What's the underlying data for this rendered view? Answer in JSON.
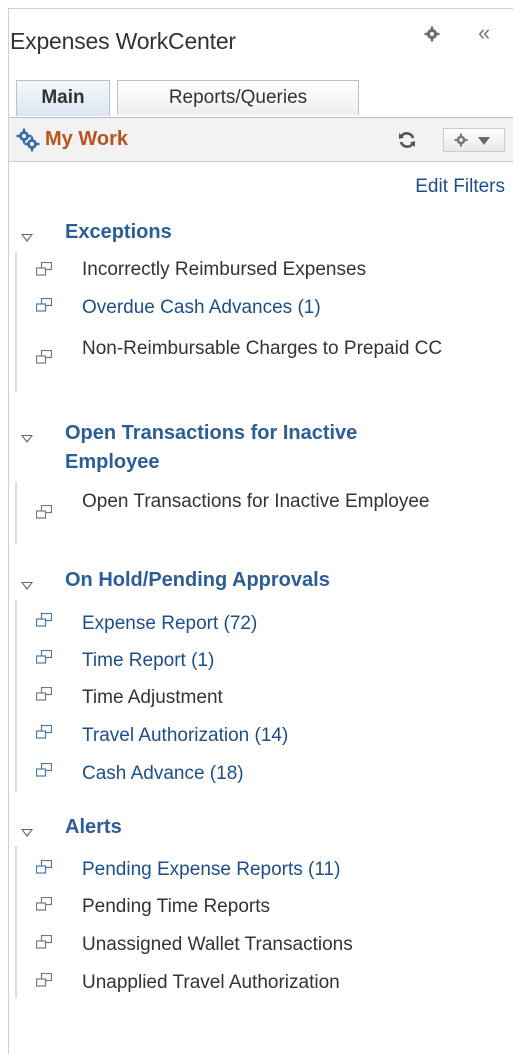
{
  "header": {
    "title": "Expenses WorkCenter",
    "collapse_label": "«"
  },
  "tabs": [
    {
      "label": "Main"
    },
    {
      "label": "Reports/Queries"
    }
  ],
  "pagelet": {
    "title": "My Work",
    "edit_filters": "Edit Filters"
  },
  "sections": [
    {
      "title": "Exceptions",
      "items": [
        {
          "label": "Incorrectly Reimbursed Expenses",
          "link": false
        },
        {
          "label": "Overdue Cash Advances (1)",
          "link": true
        },
        {
          "label": "Non-Reimbursable Charges to Prepaid CC",
          "link": false
        }
      ]
    },
    {
      "title": "Open Transactions for Inactive Employee",
      "items": [
        {
          "label": "Open Transactions for Inactive Employee",
          "link": false
        }
      ]
    },
    {
      "title": "On Hold/Pending Approvals",
      "items": [
        {
          "label": "Expense Report (72)",
          "link": true
        },
        {
          "label": "Time Report (1)",
          "link": true
        },
        {
          "label": "Time Adjustment",
          "link": false
        },
        {
          "label": "Travel Authorization (14)",
          "link": true
        },
        {
          "label": "Cash Advance (18)",
          "link": true
        }
      ]
    },
    {
      "title": "Alerts",
      "items": [
        {
          "label": "Pending Expense Reports (11)",
          "link": true
        },
        {
          "label": "Pending Time Reports",
          "link": false
        },
        {
          "label": "Unassigned Wallet Transactions",
          "link": false
        },
        {
          "label": "Unapplied Travel Authorization",
          "link": false
        }
      ]
    }
  ],
  "icons": {
    "gear": "gear-icon",
    "collapse": "collapse-icon",
    "mywork": "gears-icon",
    "refresh": "refresh-icon",
    "actions": "actions-menu-icon",
    "toggle": "triangle-down-icon",
    "item": "windows-icon"
  },
  "colors": {
    "pagelet_title": "#b5541c",
    "link": "#1c4e8a",
    "section_head": "#2b5d97",
    "text": "#333333"
  }
}
